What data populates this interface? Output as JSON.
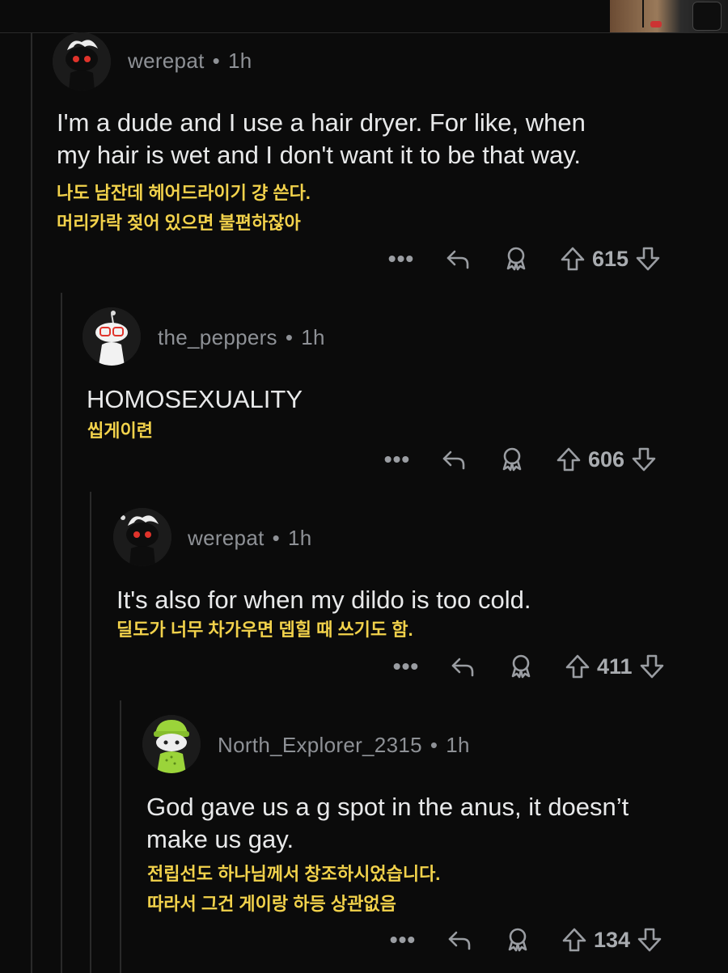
{
  "comments": [
    {
      "username": "werepat",
      "time": "1h",
      "avatar": "snoo-skunk-avatar",
      "body_en": [
        "I'm a dude and I use a hair dryer. For like, when",
        "my hair is wet and I don't want it to be that way."
      ],
      "body_ko": [
        "나도 남잔데 헤어드라이기 걍 쓴다.",
        "머리카락 젖어 있으면 불편하잖아"
      ],
      "votes": "615"
    },
    {
      "username": "the_peppers",
      "time": "1h",
      "avatar": "snoo-glasses-avatar",
      "body_en": [
        "HOMOSEXUALITY"
      ],
      "body_ko": [
        "씹게이련"
      ],
      "votes": "606"
    },
    {
      "username": "werepat",
      "time": "1h",
      "avatar": "snoo-skunk-avatar",
      "body_en": [
        "It's also for when my dildo is too cold."
      ],
      "body_ko": [
        "딜도가 너무 차가우면 뎁힐 때 쓰기도 함."
      ],
      "votes": "411"
    },
    {
      "username": "North_Explorer_2315",
      "time": "1h",
      "avatar": "snoo-green-beanie-avatar",
      "body_en": [
        "God gave us a g spot in the anus, it doesn’t",
        "make us gay."
      ],
      "body_ko": [
        "전립선도 하나님께서 창조하시었습니다.",
        "따라서 그건 게이랑 하등 상관없음"
      ],
      "votes": "134"
    }
  ],
  "icons": {
    "more": "more-options-icon",
    "reply": "reply-icon",
    "award": "award-icon",
    "upvote": "upvote-icon",
    "downvote": "downvote-icon"
  },
  "colors": {
    "background": "#0b0b0b",
    "username": "#8e9196",
    "body": "#e8e9ea",
    "translation": "#f2d24b",
    "icon": "#9a9da2"
  }
}
